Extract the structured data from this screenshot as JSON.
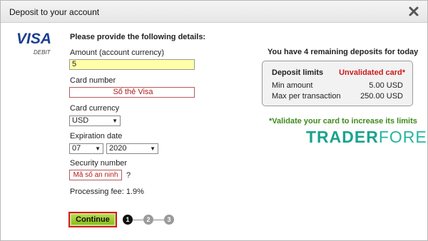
{
  "dialog": {
    "title": "Deposit to your account"
  },
  "card_brand": {
    "name": "VISA",
    "type": "DEBIT"
  },
  "form": {
    "heading": "Please provide the following details:",
    "amount_label": "Amount (account currency)",
    "amount_value": "5",
    "card_number_label": "Card number",
    "card_number_value": "Số thẻ Visa",
    "currency_label": "Card currency",
    "currency_value": "USD",
    "expiration_label": "Expiration date",
    "exp_month": "07",
    "exp_year": "2020",
    "security_label": "Security number",
    "security_value": "Mã số an ninh",
    "security_help": "?",
    "processing_fee": "Processing fee: 1.9%",
    "continue_label": "Continue",
    "steps": [
      "1",
      "2",
      "3"
    ],
    "current_step": 1
  },
  "info": {
    "remaining": "You have 4 remaining deposits for today",
    "limits_title": "Deposit limits",
    "limits_status": "Unvalidated card*",
    "min_label": "Min amount",
    "min_value": "5.00 USD",
    "max_label": "Max per transaction",
    "max_value": "250.00 USD",
    "validate_note": "*Validate your card to increase its limits"
  },
  "watermark": {
    "bold": "TRADER",
    "thin": "FOREX"
  },
  "colors": {
    "accent_red": "#cc1a1a",
    "note_green": "#3d8a1a",
    "continue_green": "#8cbd1c",
    "amount_highlight": "#ffffa8"
  }
}
